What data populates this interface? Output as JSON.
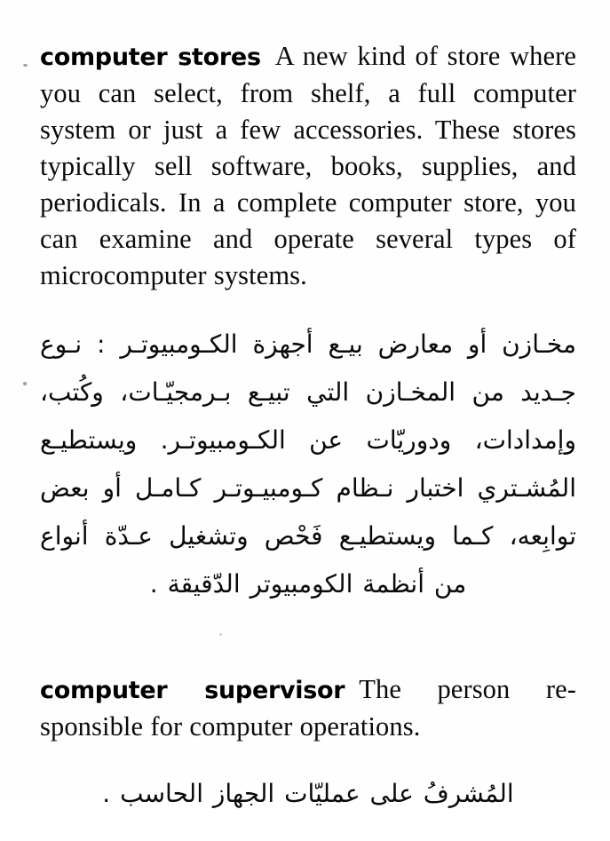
{
  "page": {
    "background_color": "#ffffff",
    "text_color": "#0a0a0a",
    "kind": "dictionary-page-scan"
  },
  "entries": [
    {
      "headword": "computer stores",
      "definition_en": "A new kind of store where you can select, from shelf, a full computer system or just a few accessories. These stores typically sell software, books, supplies, and periodicals. In a complete computer store, you can examine and operate several types of microcomputer systems.",
      "definition_ar": "مخـازن أو معارض بيـع أجهزة الكـومبيوتـر : نـوع جـديد من المخـازن التي تبيـع بـرمجيّـات، وكُتب، وإمدادات، ودوريّات عن الكـومبيوتـر. ويستطيـع المُشـتري اختبار نـظام كـومبيـوتـر كـامـل أو بعض توابِعه، كـما ويستطيـع فَحْص وتشغيل عـدّة أنواع من أنظمة الكومبيوتر الدّقيقة ."
    },
    {
      "headword": "computer supervisor",
      "definition_en": "The person re-sponsible for computer operations.",
      "definition_ar": "المُشرفُ على عمليّات الجهاز الحاسب ."
    }
  ]
}
